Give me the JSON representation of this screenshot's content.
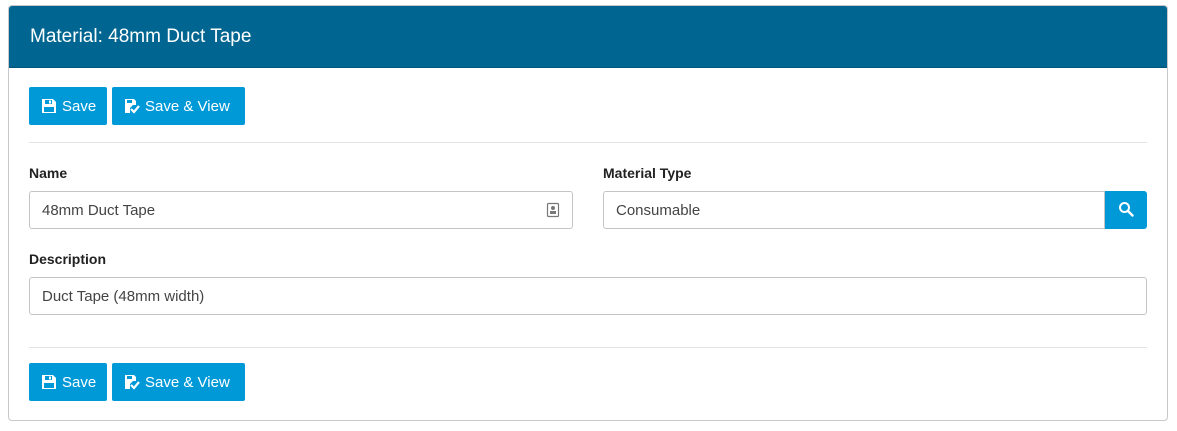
{
  "header": {
    "title": "Material: 48mm Duct Tape"
  },
  "actions": {
    "save_label": "Save",
    "save_view_label": "Save & View"
  },
  "form": {
    "name": {
      "label": "Name",
      "value": "48mm Duct Tape"
    },
    "material_type": {
      "label": "Material Type",
      "value": "Consumable"
    },
    "description": {
      "label": "Description",
      "value": "Duct Tape (48mm width)"
    }
  },
  "icons": {
    "save": "floppy-disk-icon",
    "save_view": "file-check-icon",
    "name_field": "contact-card-icon",
    "search": "search-icon"
  },
  "colors": {
    "header_bg": "#006691",
    "button_bg": "#0099d8"
  }
}
